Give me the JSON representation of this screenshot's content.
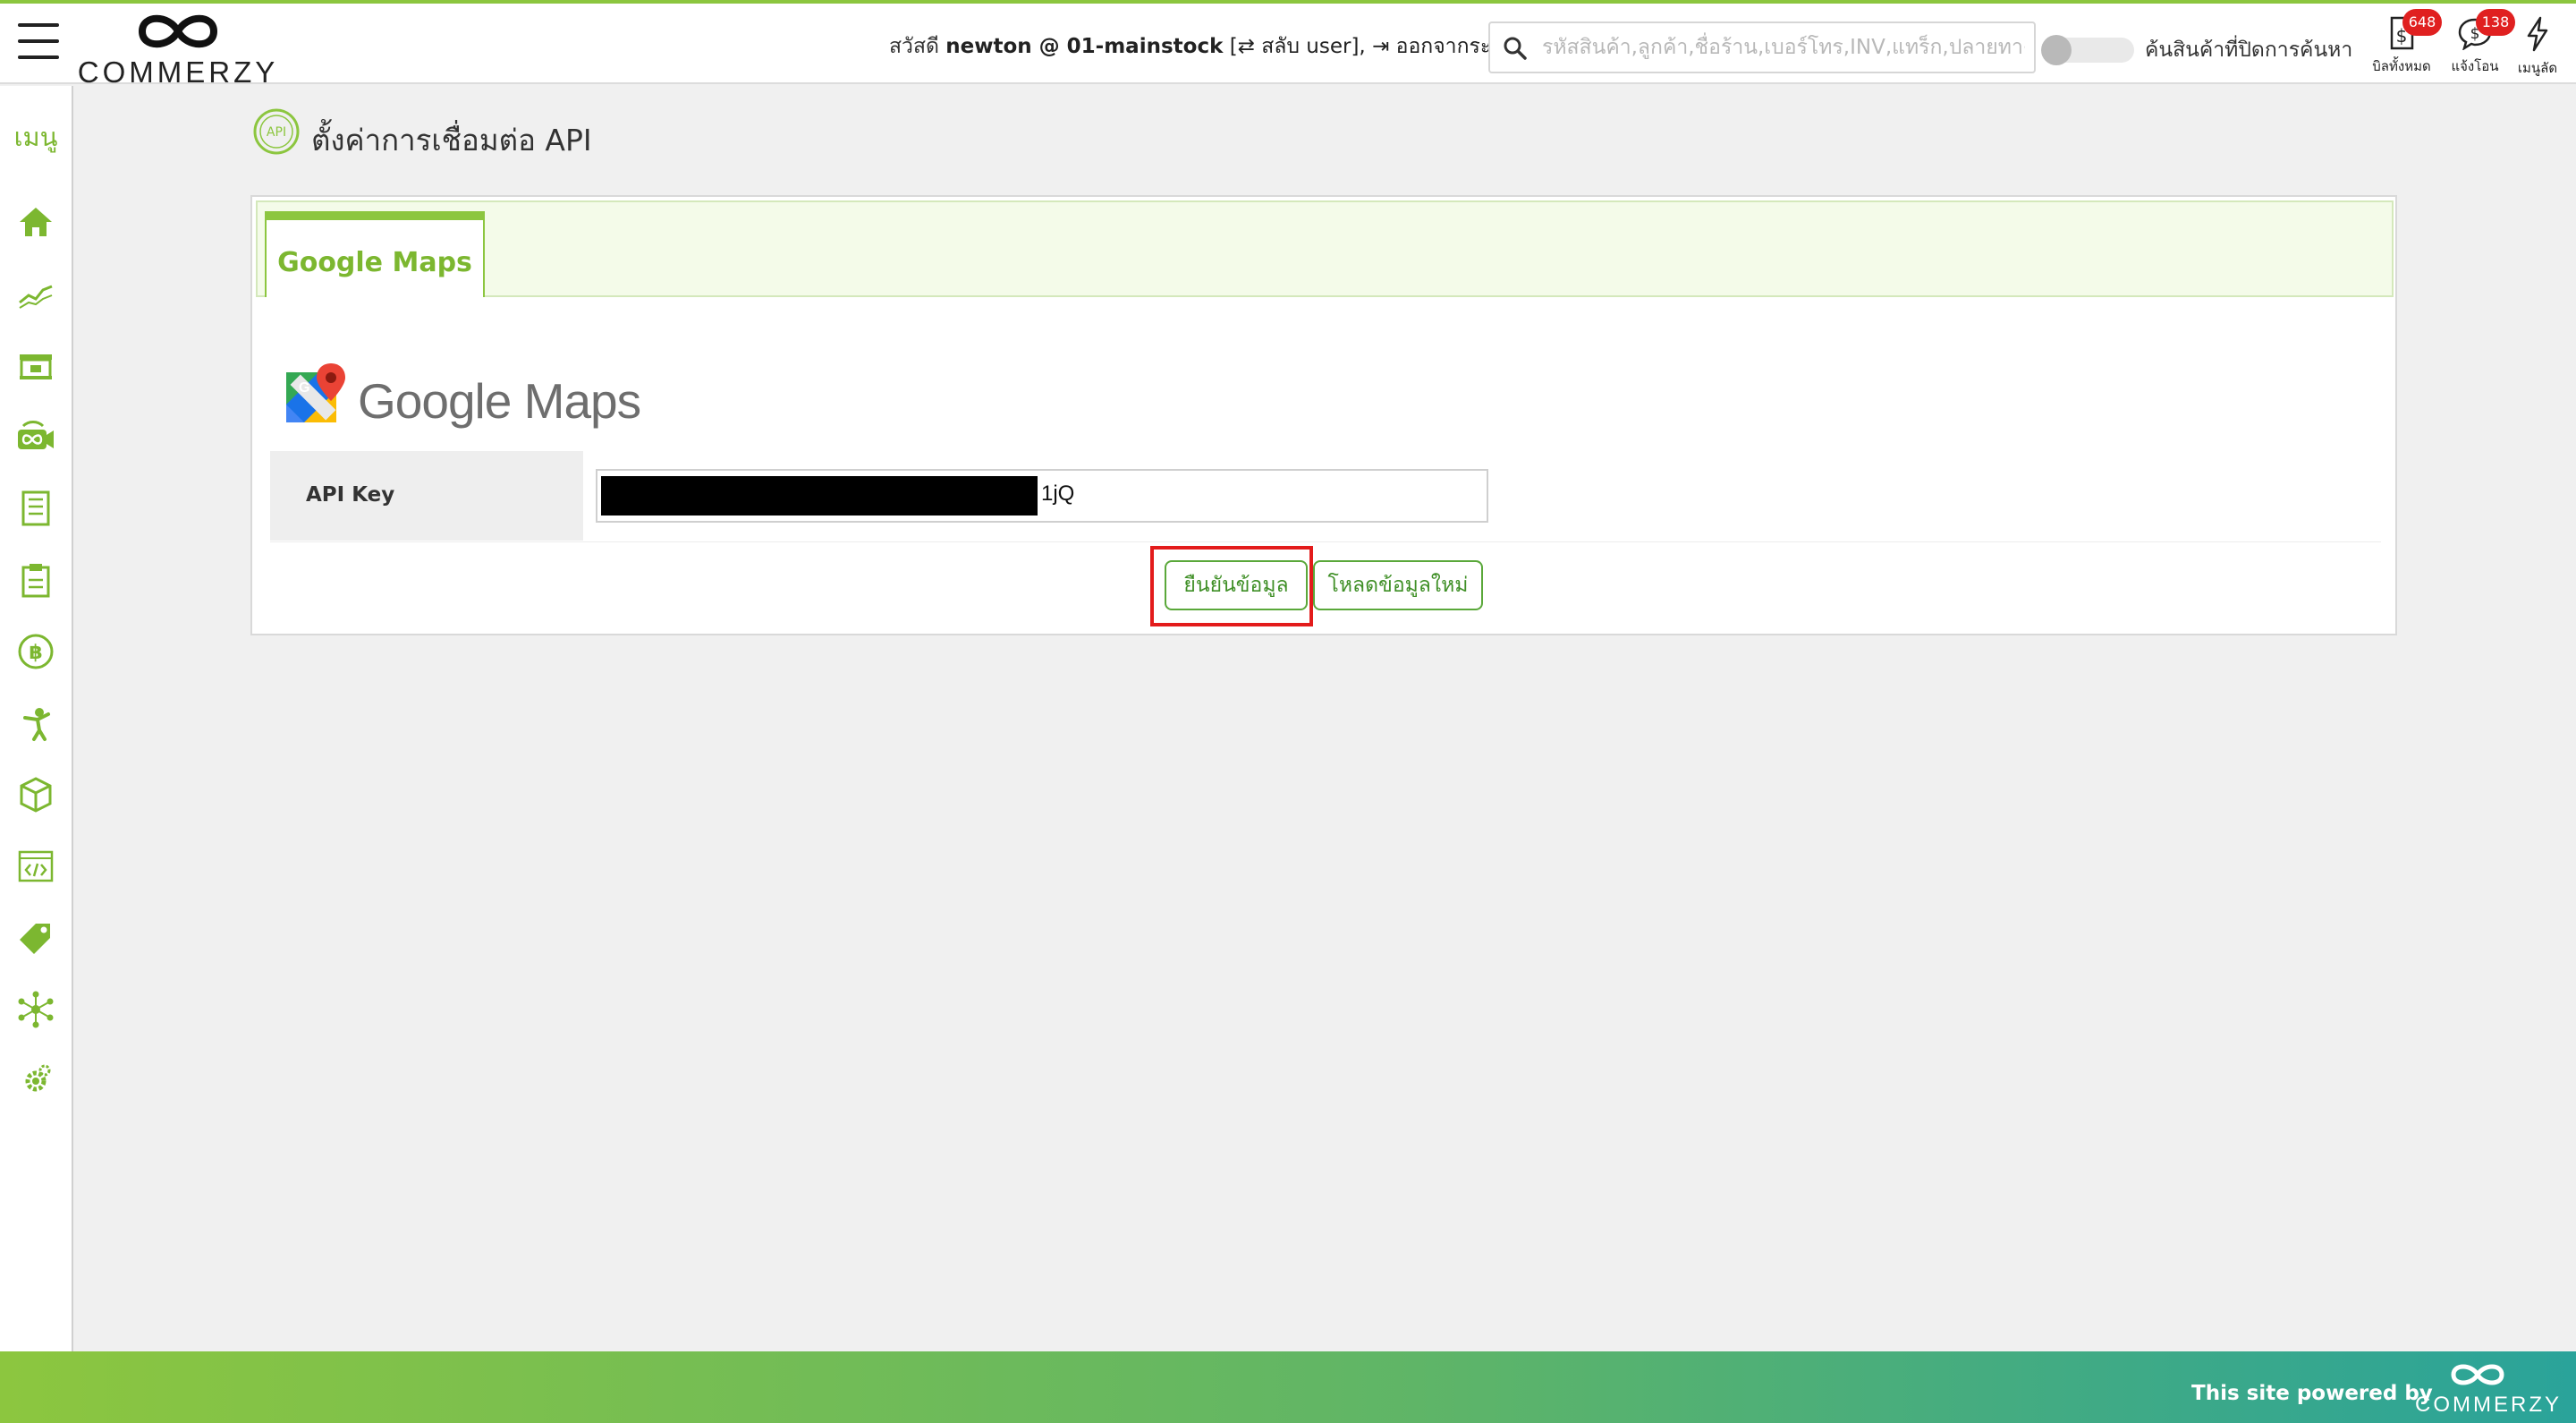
{
  "header": {
    "brand": "COMMERZY",
    "greeting_prefix": "สวัสดี",
    "user": "newton @ 01-mainstock",
    "switch_user": "[⇄ สลับ user],",
    "logout": "⇥ ออกจากระบบ",
    "search_placeholder": "รหัสสินค้า,ลูกค้า,ชื่อร้าน,เบอร์โทร,INV,แทร็ก,ปลายทาง",
    "toggle_label": "ค้นสินค้าที่ปิดการค้นหา",
    "icons": [
      {
        "name": "bills",
        "caption": "บิลทั้งหมด",
        "badge": "648"
      },
      {
        "name": "notify-transfer",
        "caption": "แจ้งโอน",
        "badge": "138"
      },
      {
        "name": "shortcut-menu",
        "caption": "เมนูลัด",
        "badge": ""
      }
    ]
  },
  "sidebar": {
    "menu_label": "เมนู",
    "items": [
      "home-icon",
      "chart-icon",
      "store-icon",
      "infinity-icon",
      "document-icon",
      "clipboard-icon",
      "baht-icon",
      "worker-icon",
      "box-icon",
      "code-icon",
      "tag-icon",
      "network-icon",
      "gear-icon"
    ]
  },
  "page": {
    "title": "ตั้งค่าการเชื่อมต่อ API",
    "title_icon": "API"
  },
  "panel": {
    "tab_label": "Google Maps",
    "logo_text": "Google Maps",
    "field_label": "API Key",
    "field_value_visible": "1jQ",
    "confirm_button": "ยืนยันข้อมูล",
    "reload_button": "โหลดข้อมูลใหม่"
  },
  "footer": {
    "powered_by": "This site powered by",
    "brand": "COMMERZY"
  },
  "colors": {
    "accent": "#8cc63f",
    "badge": "#e02020",
    "highlight": "#e31b1b",
    "button_border": "#5aa83a"
  }
}
